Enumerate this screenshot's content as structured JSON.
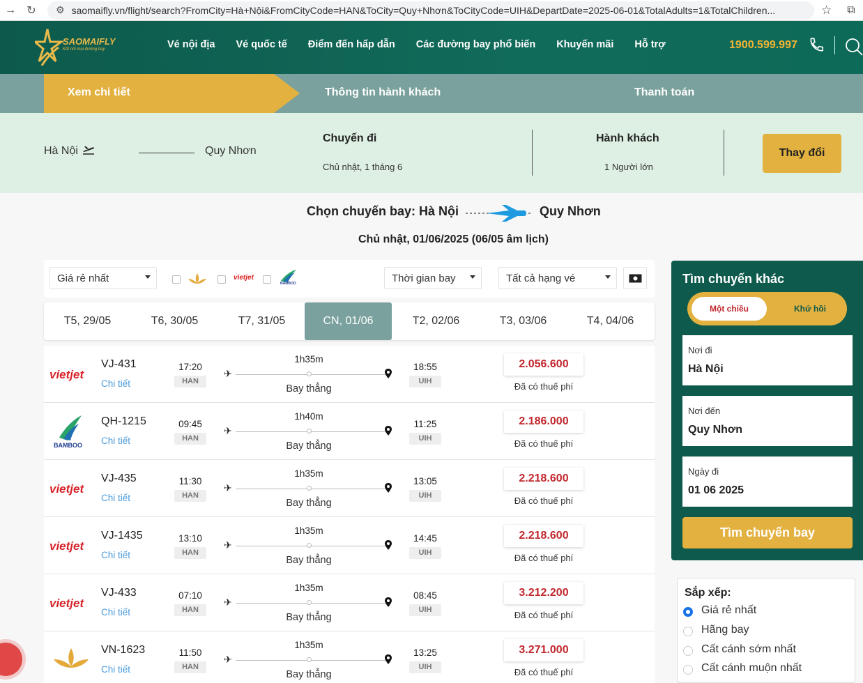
{
  "browser": {
    "url": "saomaifly.vn/flight/search?FromCity=Hà+Nội&FromCityCode=HAN&ToCity=Quy+Nhơn&ToCityCode=UIH&DepartDate=2025-06-01&TotalAdults=1&TotalChildren..."
  },
  "header": {
    "logo_text": "SAOMAIFLY",
    "logo_tagline": "Kết nối mọi đường bay",
    "nav": [
      "Vé nội địa",
      "Vé quốc tế",
      "Điểm đến hấp dẫn",
      "Các đường bay phổ biến",
      "Khuyến mãi",
      "Hỗ trợ"
    ],
    "hotline": "1900.599.997"
  },
  "steps": [
    "Xem chi tiết",
    "Thông tin hành khách",
    "Thanh toán"
  ],
  "summary": {
    "from": "Hà Nội",
    "to": "Quy Nhơn",
    "trip_heading": "Chuyến đi",
    "trip_date": "Chủ nhật, 1 tháng 6",
    "pax_heading": "Hành khách",
    "pax_value": "1 Người lớn",
    "change_label": "Thay đổi"
  },
  "route": {
    "title": "Chọn chuyến bay: Hà Nội",
    "to": "Quy Nhơn",
    "date": "Chủ nhật, 01/06/2025 (06/05 âm lịch)"
  },
  "filters": {
    "sort_select": "Giá rẻ nhất",
    "airline_vietjet_text": "vietjet",
    "airline_bamboo_text": "BAMBOO",
    "time_select": "Thời gian bay",
    "class_select": "Tất cả hạng vé"
  },
  "date_tabs": [
    "T5, 29/05",
    "T6, 30/05",
    "T7, 31/05",
    "CN, 01/06",
    "T2, 02/06",
    "T3, 03/06",
    "T4, 04/06"
  ],
  "flights": [
    {
      "airline": "vietjet",
      "code": "VJ-431",
      "dep": "17:20",
      "arr": "18:55",
      "duration": "1h35m",
      "price": "2.056.600"
    },
    {
      "airline": "bamboo",
      "code": "QH-1215",
      "dep": "09:45",
      "arr": "11:25",
      "duration": "1h40m",
      "price": "2.186.000"
    },
    {
      "airline": "vietjet",
      "code": "VJ-435",
      "dep": "11:30",
      "arr": "13:05",
      "duration": "1h35m",
      "price": "2.218.600"
    },
    {
      "airline": "vietjet",
      "code": "VJ-1435",
      "dep": "13:10",
      "arr": "14:45",
      "duration": "1h35m",
      "price": "2.218.600"
    },
    {
      "airline": "vietjet",
      "code": "VJ-433",
      "dep": "07:10",
      "arr": "08:45",
      "duration": "1h35m",
      "price": "3.212.200"
    },
    {
      "airline": "vna",
      "code": "VN-1623",
      "dep": "11:50",
      "arr": "13:25",
      "duration": "1h35m",
      "price": "3.271.000"
    }
  ],
  "flight_common": {
    "detail_label": "Chi tiết",
    "from_code": "HAN",
    "to_code": "UIH",
    "nonstop": "Bay thẳng",
    "tax_note": "Đã có thuế phí",
    "vietjet_text": "vietjet",
    "bamboo_text": "BAMBOO"
  },
  "sidebar": {
    "title": "Tìm chuyến khác",
    "one_way": "Một chiều",
    "round_trip": "Khứ hồi",
    "from_label": "Nơi đi",
    "from_value": "Hà Nội",
    "to_label": "Nơi đến",
    "to_value": "Quy Nhơn",
    "date_label": "Ngày đi",
    "date_value": "01 06 2025",
    "search_label": "Tìm chuyến bay"
  },
  "sort": {
    "title": "Sắp xếp:",
    "options": [
      "Giá rẻ nhất",
      "Hãng bay",
      "Cất cánh sớm nhất",
      "Cất cánh muộn nhất"
    ]
  },
  "colors": {
    "brand_green": "#0e5a4c",
    "gold": "#e3b13f",
    "price_red": "#c1272d",
    "link_blue": "#4b9bdc"
  }
}
